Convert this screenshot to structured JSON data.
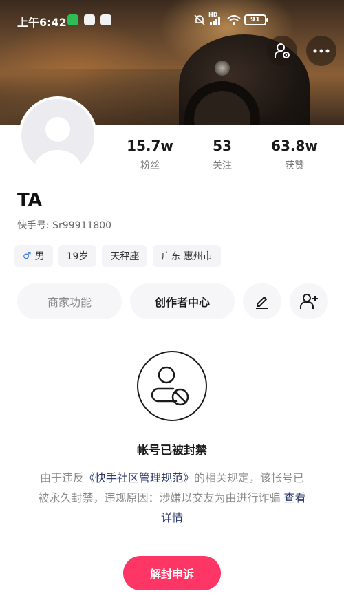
{
  "status_bar": {
    "time": "上午6:42",
    "battery": "91",
    "network": "HD"
  },
  "profile": {
    "name": "TA",
    "uid": "快手号: Sr99911800",
    "stats": [
      {
        "value": "15.7w",
        "label": "粉丝"
      },
      {
        "value": "53",
        "label": "关注"
      },
      {
        "value": "63.8w",
        "label": "获赞"
      }
    ],
    "tags": {
      "gender_symbol": "♂",
      "gender": "男",
      "age": "19岁",
      "zodiac": "天秤座",
      "location": "广东 惠州市"
    }
  },
  "actions": {
    "merchant": "商家功能",
    "creator": "创作者中心"
  },
  "ban": {
    "title": "帐号已被封禁",
    "desc_prefix": "由于违反",
    "rule_link": "《快手社区管理规范》",
    "desc_suffix": "的相关规定，该帐号已被永久封禁，违规原因：涉嫌以交友为由进行诈骗",
    "details_link": "查看详情",
    "appeal_button": "解封申诉"
  },
  "colors": {
    "accent": "#fe3666",
    "link": "#2d3a6b",
    "male": "#3c7be6"
  },
  "icons": [
    "user-settings-icon",
    "more-icon",
    "edit-icon",
    "add-friend-icon",
    "account-banned-icon"
  ]
}
